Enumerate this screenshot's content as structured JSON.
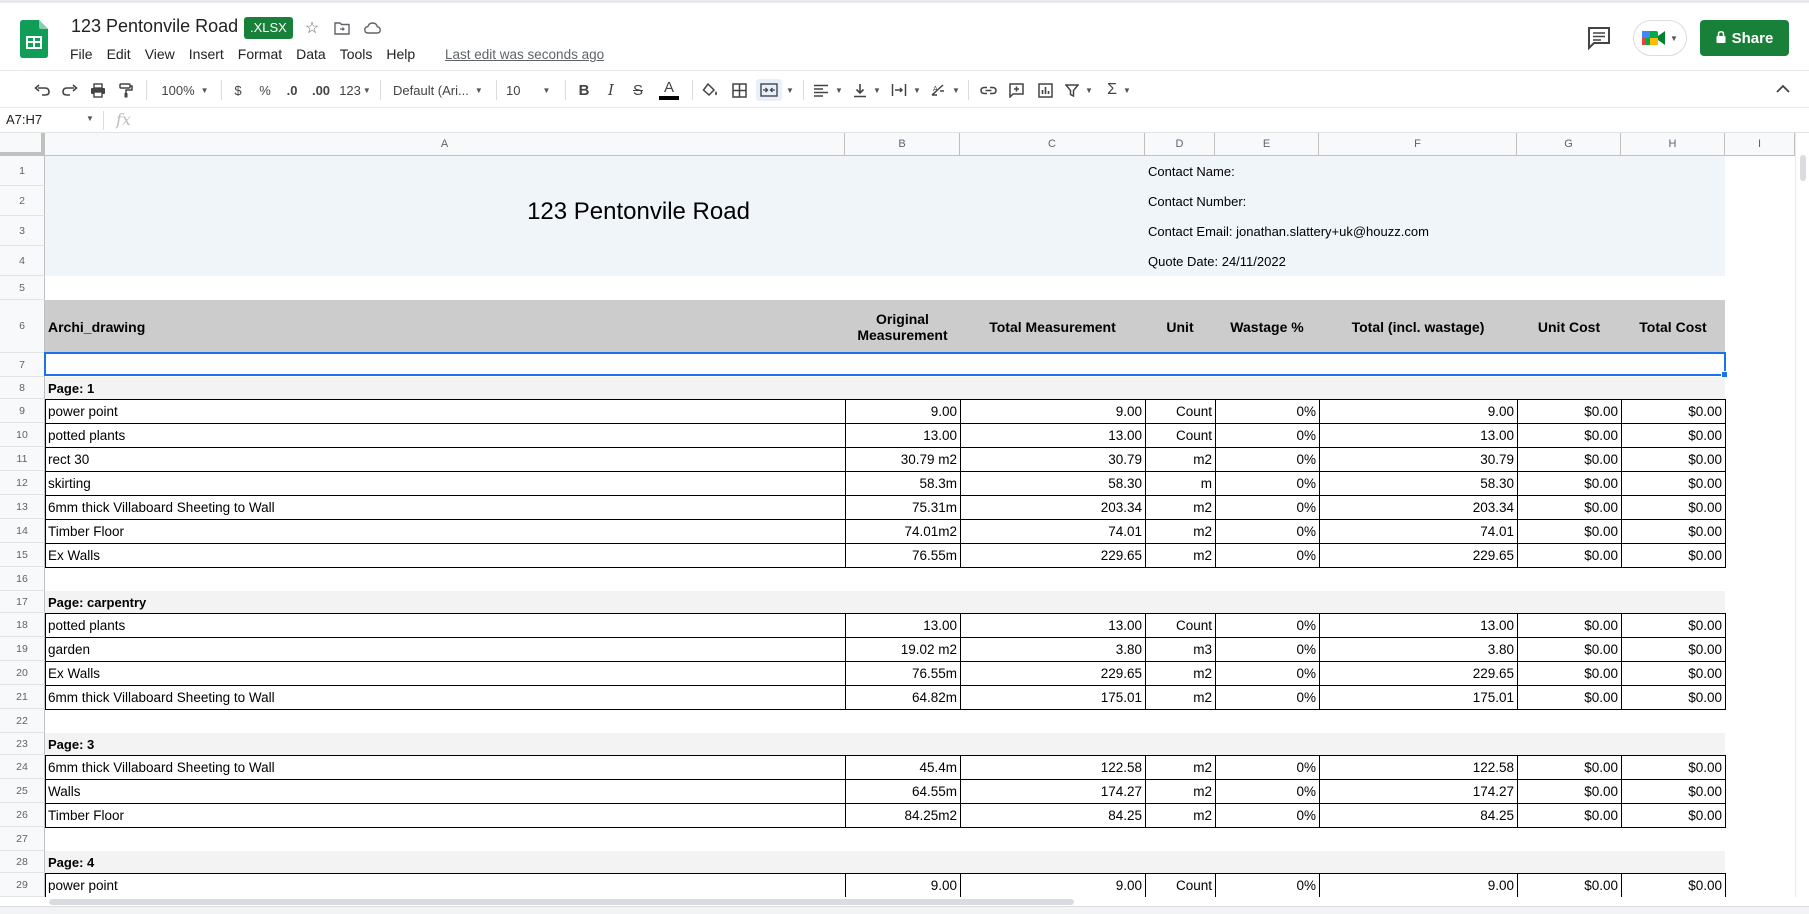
{
  "app": {
    "doc_title": "123 Pentonvile Road",
    "file_badge": ".XLSX",
    "menu": [
      "File",
      "Edit",
      "View",
      "Insert",
      "Format",
      "Data",
      "Tools",
      "Help"
    ],
    "last_edit": "Last edit was seconds ago",
    "share_label": "Share",
    "accent_color": "#188038"
  },
  "toolbar": {
    "zoom": "100%",
    "currency": "$",
    "percent": "%",
    "dec_decrease": ".0",
    "dec_increase": ".00",
    "number_format": "123",
    "font": "Default (Ari...",
    "font_size": "10",
    "bold": "B",
    "italic": "I",
    "strike": "S",
    "text_color": "A"
  },
  "formula_bar": {
    "name_box": "A7:H7",
    "fx": "fx"
  },
  "columns": [
    "A",
    "B",
    "C",
    "D",
    "E",
    "F",
    "G",
    "H",
    "I"
  ],
  "header_block": {
    "title": "123 Pentonvile Road",
    "contact_name": "Contact Name:",
    "contact_number": "Contact Number:",
    "contact_email": "Contact Email: jonathan.slattery+uk@houzz.com",
    "quote_date": "Quote Date: 24/11/2022"
  },
  "table_header": {
    "a": "Archi_drawing",
    "b": "Original Measurement",
    "c": "Total Measurement",
    "d": "Unit",
    "e": "Wastage %",
    "f": "Total (incl. wastage)",
    "g": "Unit Cost",
    "h": "Total Cost"
  },
  "rows": [
    {
      "n": "1"
    },
    {
      "n": "2"
    },
    {
      "n": "3"
    },
    {
      "n": "4"
    },
    {
      "n": "5"
    },
    {
      "n": "6"
    },
    {
      "n": "7"
    },
    {
      "n": "8",
      "section": "Page: 1"
    },
    {
      "n": "9",
      "cells": [
        "power point",
        "9.00",
        "9.00",
        "Count",
        "0%",
        "9.00",
        "$0.00",
        "$0.00"
      ]
    },
    {
      "n": "10",
      "cells": [
        "potted plants",
        "13.00",
        "13.00",
        "Count",
        "0%",
        "13.00",
        "$0.00",
        "$0.00"
      ]
    },
    {
      "n": "11",
      "cells": [
        "rect 30",
        "30.79 m2",
        "30.79",
        "m2",
        "0%",
        "30.79",
        "$0.00",
        "$0.00"
      ]
    },
    {
      "n": "12",
      "cells": [
        "skirting",
        "58.3m",
        "58.30",
        "m",
        "0%",
        "58.30",
        "$0.00",
        "$0.00"
      ]
    },
    {
      "n": "13",
      "cells": [
        "6mm thick Villaboard Sheeting to Wall",
        "75.31m",
        "203.34",
        "m2",
        "0%",
        "203.34",
        "$0.00",
        "$0.00"
      ]
    },
    {
      "n": "14",
      "cells": [
        "Timber Floor",
        "74.01m2",
        "74.01",
        "m2",
        "0%",
        "74.01",
        "$0.00",
        "$0.00"
      ]
    },
    {
      "n": "15",
      "cells": [
        "Ex Walls",
        "76.55m",
        "229.65",
        "m2",
        "0%",
        "229.65",
        "$0.00",
        "$0.00"
      ]
    },
    {
      "n": "16"
    },
    {
      "n": "17",
      "section": "Page: carpentry"
    },
    {
      "n": "18",
      "cells": [
        "potted plants",
        "13.00",
        "13.00",
        "Count",
        "0%",
        "13.00",
        "$0.00",
        "$0.00"
      ]
    },
    {
      "n": "19",
      "cells": [
        "garden",
        "19.02 m2",
        "3.80",
        "m3",
        "0%",
        "3.80",
        "$0.00",
        "$0.00"
      ]
    },
    {
      "n": "20",
      "cells": [
        "Ex Walls",
        "76.55m",
        "229.65",
        "m2",
        "0%",
        "229.65",
        "$0.00",
        "$0.00"
      ]
    },
    {
      "n": "21",
      "cells": [
        "6mm thick Villaboard Sheeting to Wall",
        "64.82m",
        "175.01",
        "m2",
        "0%",
        "175.01",
        "$0.00",
        "$0.00"
      ]
    },
    {
      "n": "22"
    },
    {
      "n": "23",
      "section": "Page: 3"
    },
    {
      "n": "24",
      "cells": [
        "6mm thick Villaboard Sheeting to Wall",
        "45.4m",
        "122.58",
        "m2",
        "0%",
        "122.58",
        "$0.00",
        "$0.00"
      ]
    },
    {
      "n": "25",
      "cells": [
        "Walls",
        "64.55m",
        "174.27",
        "m2",
        "0%",
        "174.27",
        "$0.00",
        "$0.00"
      ]
    },
    {
      "n": "26",
      "cells": [
        "Timber Floor",
        "84.25m2",
        "84.25",
        "m2",
        "0%",
        "84.25",
        "$0.00",
        "$0.00"
      ]
    },
    {
      "n": "27"
    },
    {
      "n": "28",
      "section": "Page: 4"
    },
    {
      "n": "29",
      "cells": [
        "power point",
        "9.00",
        "9.00",
        "Count",
        "0%",
        "9.00",
        "$0.00",
        "$0.00"
      ]
    }
  ]
}
